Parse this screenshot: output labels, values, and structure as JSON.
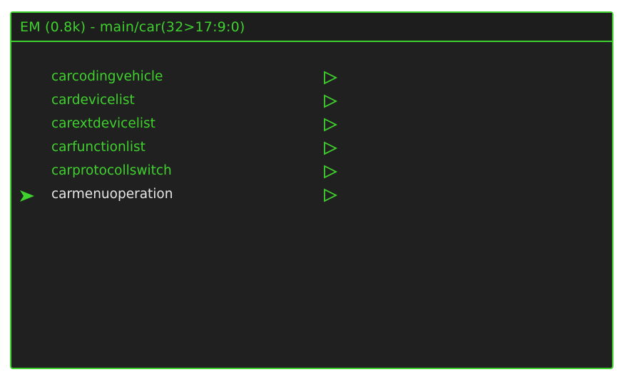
{
  "window": {
    "title": "EM (0.8k) - main/car(32>17:9:0)"
  },
  "menu": {
    "items": [
      {
        "label": "carcodingvehicle",
        "selected": false,
        "icon": "submenu-arrow-icon"
      },
      {
        "label": "cardevicelist",
        "selected": false,
        "icon": "submenu-arrow-icon"
      },
      {
        "label": "carextdevicelist",
        "selected": false,
        "icon": "submenu-arrow-icon"
      },
      {
        "label": "carfunctionlist",
        "selected": false,
        "icon": "submenu-arrow-icon"
      },
      {
        "label": "carprotocollswitch",
        "selected": false,
        "icon": "submenu-arrow-icon"
      },
      {
        "label": "carmenuoperation",
        "selected": true,
        "icon": "submenu-arrow-icon"
      }
    ],
    "selector_icon": "selection-pointer-icon"
  },
  "colors": {
    "accent_green": "#3fd12d",
    "background": "#202020",
    "selected_text": "#e6e6e6",
    "outer_background": "#ffffff"
  }
}
